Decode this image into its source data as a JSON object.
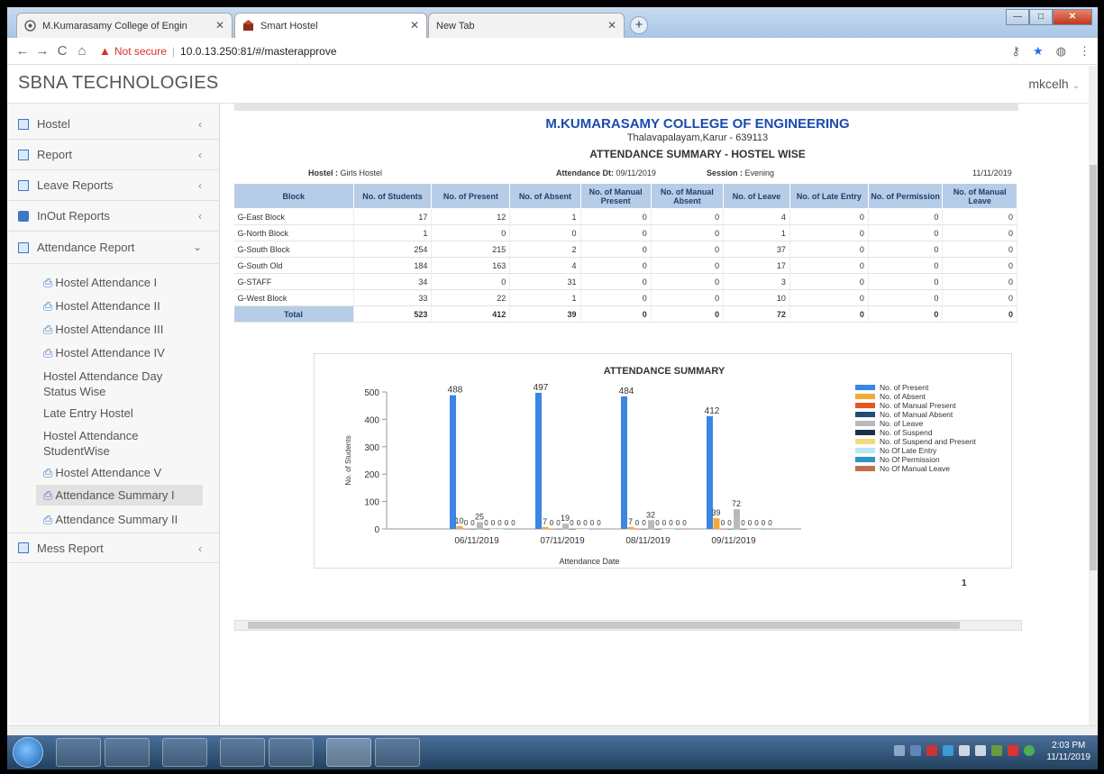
{
  "browser": {
    "tabs": [
      {
        "label": "M.Kumarasamy College of Engin",
        "active": false
      },
      {
        "label": "Smart Hostel",
        "active": true
      },
      {
        "label": "New Tab",
        "active": false
      }
    ],
    "new_tab": "+",
    "nav": {
      "back": "←",
      "forward": "→",
      "reload": "C",
      "home": "⌂"
    },
    "security_warning": "Not secure",
    "url": "10.0.13.250:81/#/masterapprove",
    "window_controls": {
      "minimize": "—",
      "maximize": "□",
      "close": "✕"
    }
  },
  "app": {
    "brand": "SBNA TECHNOLOGIES",
    "user": "mkcelh"
  },
  "sidebar": {
    "items": [
      {
        "label": "Hostel",
        "icon": "calendar-icon"
      },
      {
        "label": "Report",
        "icon": "report-icon"
      },
      {
        "label": "Leave Reports",
        "icon": "report-icon"
      },
      {
        "label": "InOut Reports",
        "icon": "print-icon"
      },
      {
        "label": "Attendance Report",
        "icon": "report-icon"
      },
      {
        "label": "Mess Report",
        "icon": "report-icon"
      }
    ],
    "subitems": [
      {
        "label": "Hostel Attendance I",
        "icon": "print-icon"
      },
      {
        "label": "Hostel Attendance II",
        "icon": "print-icon"
      },
      {
        "label": "Hostel Attendance III",
        "icon": "print-icon"
      },
      {
        "label": "Hostel Attendance IV",
        "icon": "print-icon"
      },
      {
        "label": "Hostel Attendance Day Status Wise",
        "icon": ""
      },
      {
        "label": "Late Entry Hostel",
        "icon": ""
      },
      {
        "label": "Hostel Attendance StudentWise",
        "icon": ""
      },
      {
        "label": "Hostel Attendance V",
        "icon": "print-icon"
      },
      {
        "label": "Attendance Summary I",
        "icon": "print-icon",
        "selected": true
      },
      {
        "label": "Attendance Summary II",
        "icon": "print-icon"
      }
    ]
  },
  "report": {
    "college": "M.KUMARASAMY COLLEGE OF ENGINEERING",
    "address": "Thalavapalayam,Karur - 639113",
    "title": "ATTENDANCE SUMMARY - HOSTEL WISE",
    "hostel_label": "Hostel :",
    "hostel": "Girls Hostel",
    "date_label": "Attendance Dt:",
    "date": "09/11/2019",
    "session_label": "Session :",
    "session": "Evening",
    "printed_date": "11/11/2019",
    "page": "1",
    "columns": [
      "Block",
      "No. of Students",
      "No. of Present",
      "No. of Absent",
      "No. of Manual Present",
      "No. of Manual Absent",
      "No. of Leave",
      "No. of Late Entry",
      "No. of Permission",
      "No. of Manual Leave"
    ],
    "rows": [
      [
        "G-East Block",
        "17",
        "12",
        "1",
        "0",
        "0",
        "4",
        "0",
        "0",
        "0"
      ],
      [
        "G-North Block",
        "1",
        "0",
        "0",
        "0",
        "0",
        "1",
        "0",
        "0",
        "0"
      ],
      [
        "G-South Block",
        "254",
        "215",
        "2",
        "0",
        "0",
        "37",
        "0",
        "0",
        "0"
      ],
      [
        "G-South Old",
        "184",
        "163",
        "4",
        "0",
        "0",
        "17",
        "0",
        "0",
        "0"
      ],
      [
        "G-STAFF",
        "34",
        "0",
        "31",
        "0",
        "0",
        "3",
        "0",
        "0",
        "0"
      ],
      [
        "G-West Block",
        "33",
        "22",
        "1",
        "0",
        "0",
        "10",
        "0",
        "0",
        "0"
      ]
    ],
    "total": [
      "Total",
      "523",
      "412",
      "39",
      "0",
      "0",
      "72",
      "0",
      "0",
      "0"
    ]
  },
  "chart_data": {
    "type": "bar",
    "title": "ATTENDANCE SUMMARY",
    "xlabel": "Attendance Date",
    "ylabel": "No. of Students",
    "ylim": [
      0,
      500
    ],
    "yticks": [
      0,
      100,
      200,
      300,
      400,
      500
    ],
    "categories": [
      "06/11/2019",
      "07/11/2019",
      "08/11/2019",
      "09/11/2019"
    ],
    "legend_position": "right",
    "series": [
      {
        "name": "No. of Present",
        "color": "#3b86e3",
        "values": [
          488,
          497,
          484,
          412
        ]
      },
      {
        "name": "No. of Absent",
        "color": "#f3a93a",
        "values": [
          10,
          7,
          7,
          39
        ]
      },
      {
        "name": "No. of Manual Present",
        "color": "#e6541f",
        "values": [
          0,
          0,
          0,
          0
        ]
      },
      {
        "name": "No. of Manual Absent",
        "color": "#234b78",
        "values": [
          0,
          0,
          0,
          0
        ]
      },
      {
        "name": "No. of Leave",
        "color": "#b9b9b9",
        "values": [
          25,
          19,
          32,
          72
        ]
      },
      {
        "name": "No. of Suspend",
        "color": "#1d3048",
        "values": [
          0,
          0,
          0,
          0
        ]
      },
      {
        "name": "No. of Suspend and Present",
        "color": "#f6d87e",
        "values": [
          0,
          0,
          0,
          0
        ]
      },
      {
        "name": "No Of Late Entry",
        "color": "#b9e6f5",
        "values": [
          0,
          0,
          0,
          0
        ]
      },
      {
        "name": "No Of Permission",
        "color": "#2c95c6",
        "values": [
          0,
          0,
          0,
          0
        ]
      },
      {
        "name": "No Of Manual Leave",
        "color": "#c0714a",
        "values": [
          0,
          0,
          0,
          0
        ]
      }
    ]
  },
  "taskbar": {
    "time": "2:03 PM",
    "date": "11/11/2019"
  }
}
